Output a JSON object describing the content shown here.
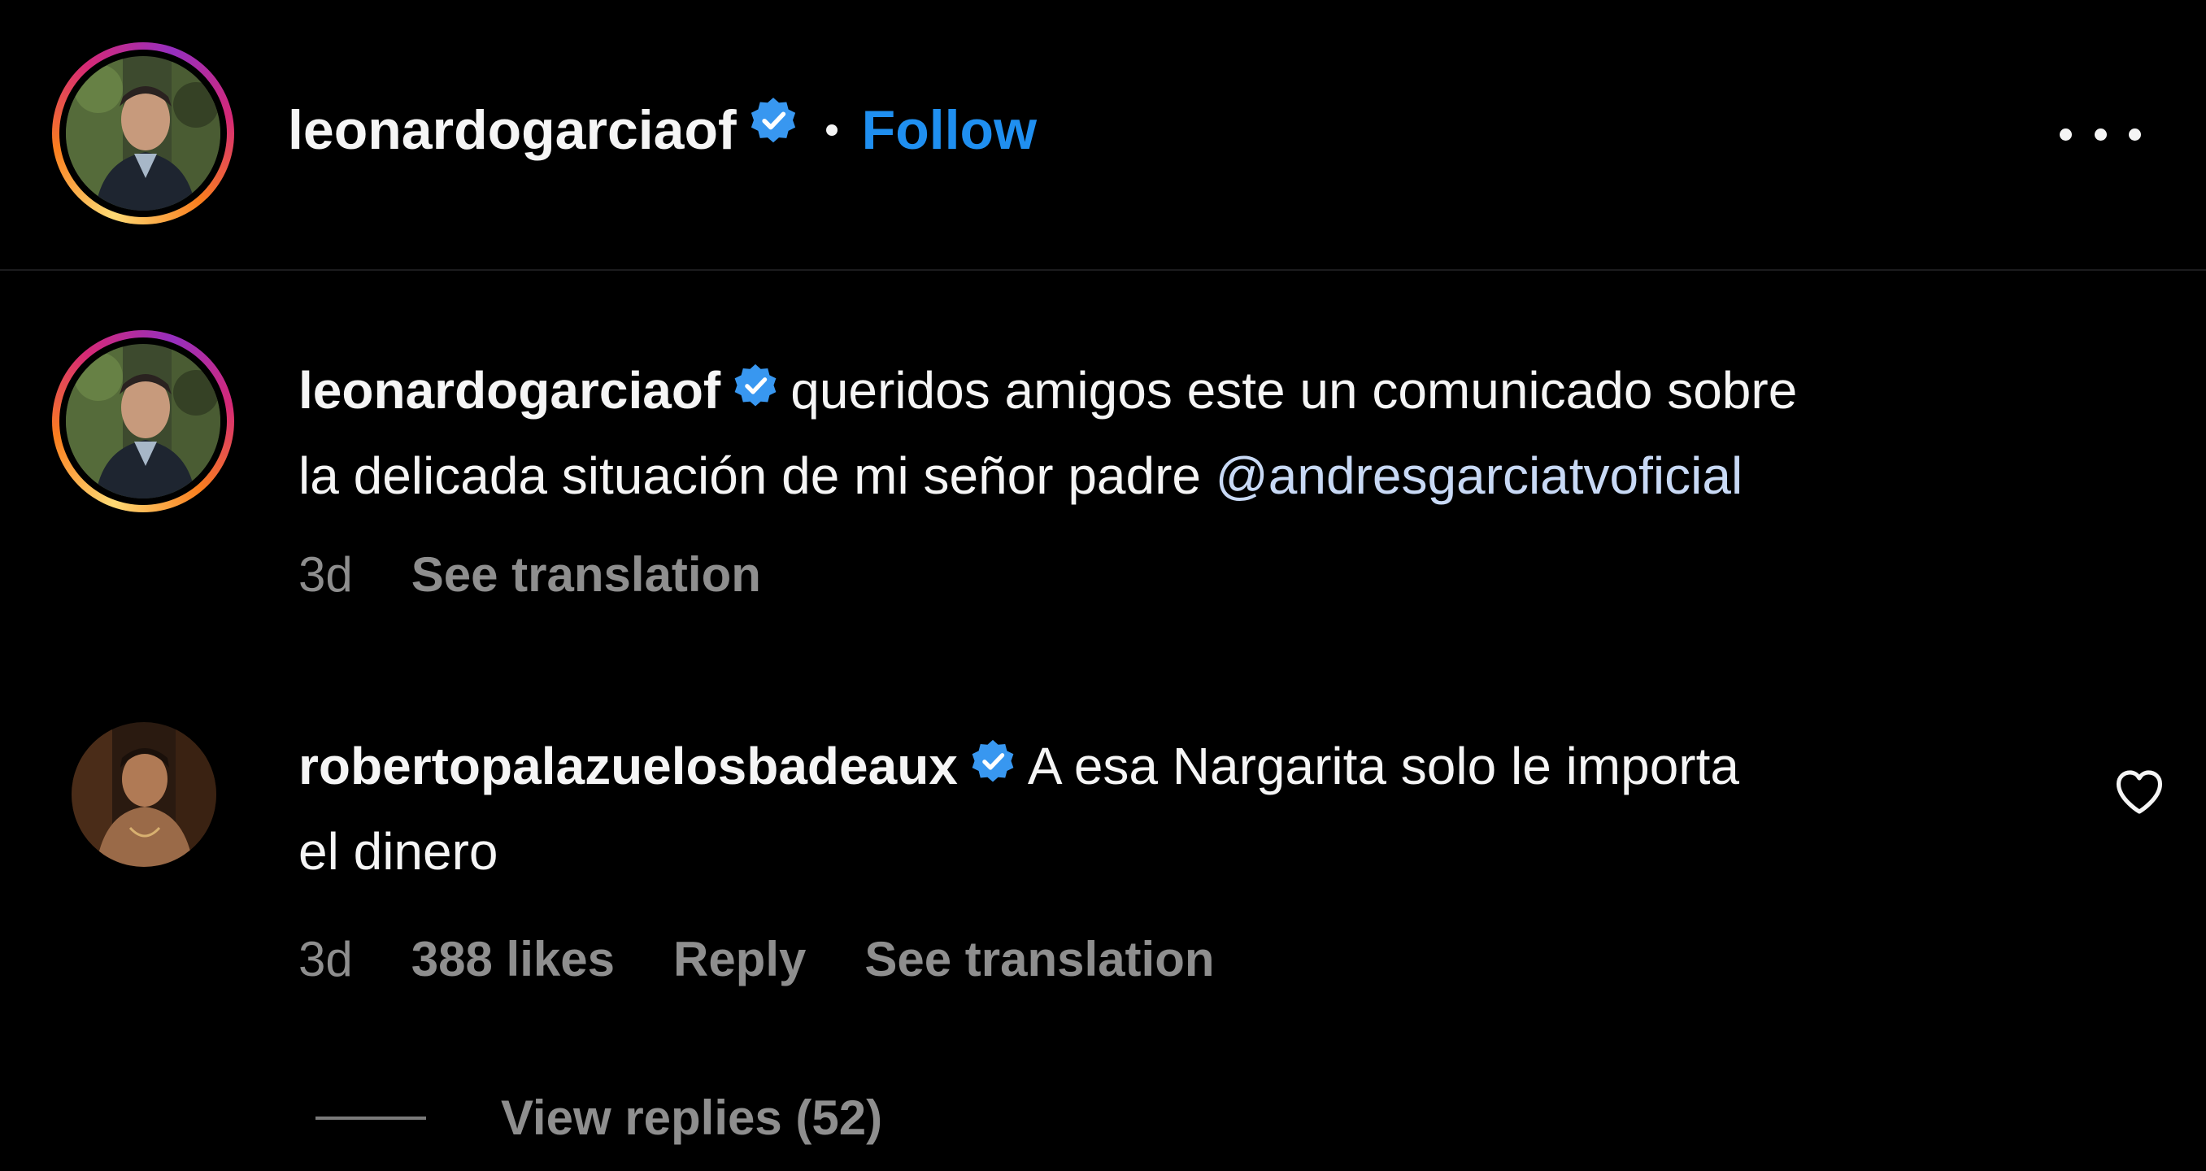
{
  "header": {
    "username": "leonardogarciaof",
    "follow_label": "Follow"
  },
  "caption": {
    "username": "leonardogarciaof",
    "text_line1": "queridos amigos este un comunicado sobre",
    "text_line2": "la delicada situación de mi señor padre",
    "mention": "@andresgarciatvoficial",
    "time": "3d",
    "see_translation": "See translation"
  },
  "comment": {
    "username": "robertopalazuelosbadeaux",
    "text_line1": "A esa Nargarita solo le importa",
    "text_line2": "el dinero",
    "time": "3d",
    "likes": "388 likes",
    "reply_label": "Reply",
    "see_translation": "See translation",
    "view_replies": "View replies (52)"
  },
  "colors": {
    "background": "#000000",
    "link_blue": "#1f8ff0",
    "mention": "#c8d9f5",
    "muted": "#8e8e8e",
    "verified": "#3897f0"
  },
  "icons": {
    "verified": "verified-badge-icon",
    "more": "more-options-icon",
    "like": "heart-outline-icon"
  }
}
